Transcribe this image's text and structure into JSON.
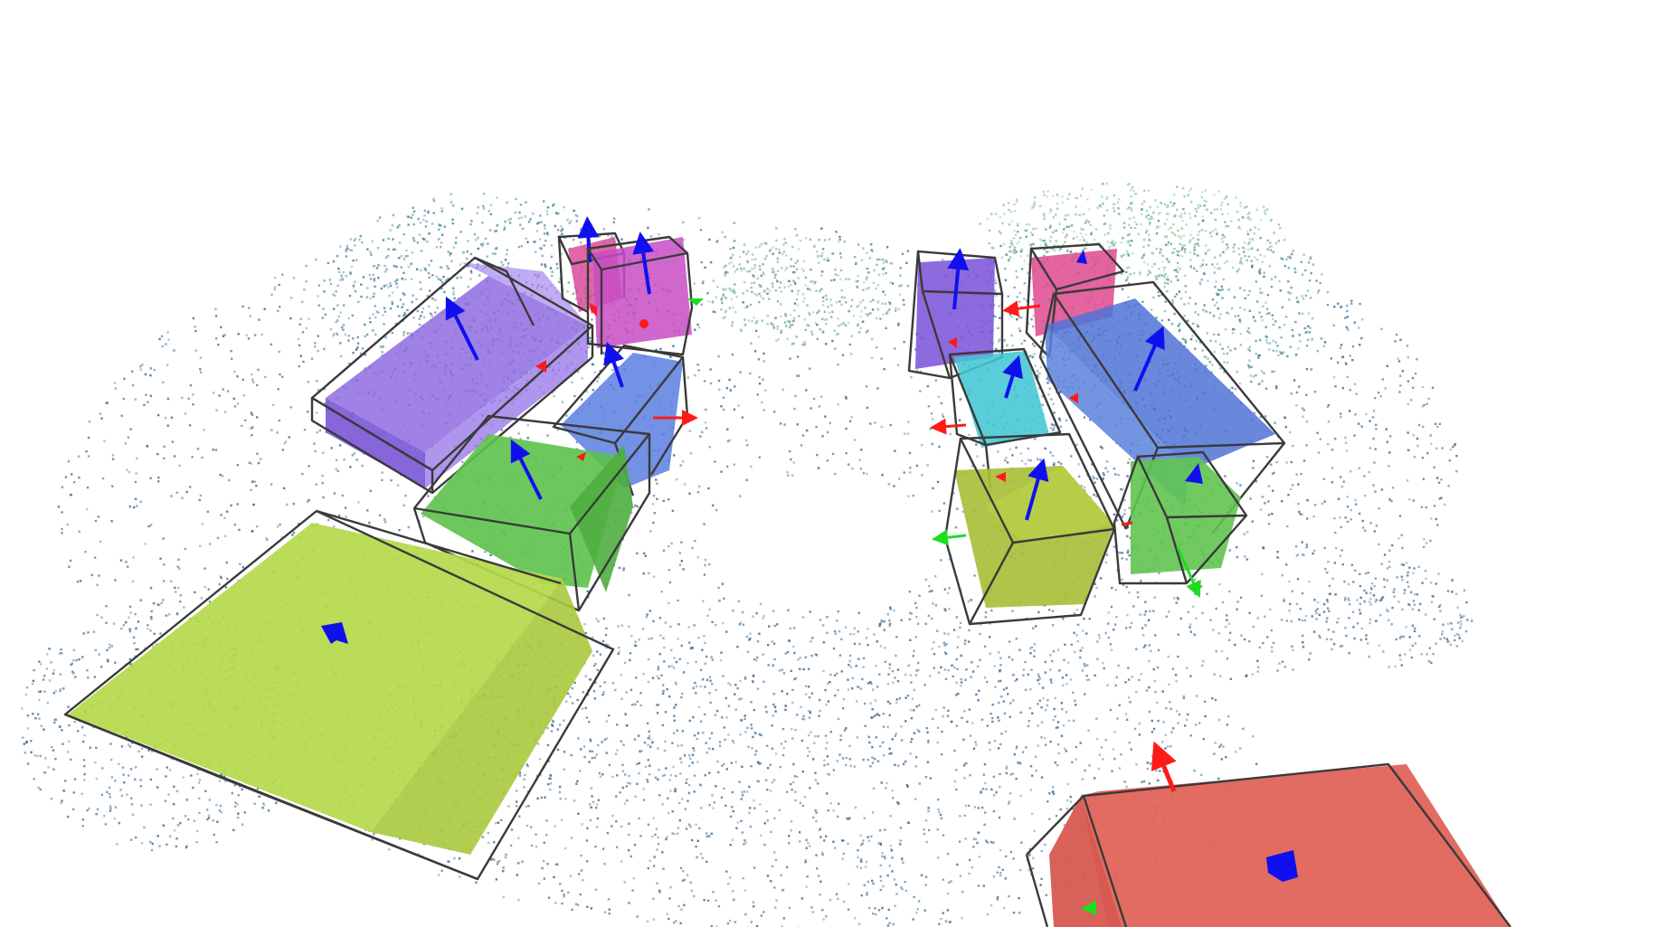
{
  "scene": {
    "background": "#ffffff",
    "point_cloud_color_near": "#2f5f85",
    "point_cloud_color_far": "#7fbf8a",
    "box_edge_color": "#3a3a3a",
    "axis_colors": {
      "x": "#ff1a1a",
      "y": "#1fdc1f",
      "z": "#1010ee"
    },
    "objects": [
      {
        "id": "sofa-left",
        "color": "#8f6be0"
      },
      {
        "id": "chair-back-left-pink",
        "color": "#d94c9a"
      },
      {
        "id": "chair-back-left-magenta",
        "color": "#c84cc4"
      },
      {
        "id": "chair-mid-left-blue",
        "color": "#5b7fe0"
      },
      {
        "id": "chair-front-left-green",
        "color": "#5cc24a"
      },
      {
        "id": "table-left-lime",
        "color": "#b4d94a"
      },
      {
        "id": "chair-back-right-purple",
        "color": "#7d55d8"
      },
      {
        "id": "chair-back-right-pink",
        "color": "#df4f91"
      },
      {
        "id": "chair-mid-right-cyan",
        "color": "#43c7d3"
      },
      {
        "id": "sofa-right-blue",
        "color": "#4f73d6"
      },
      {
        "id": "chair-front-right-olive",
        "color": "#a9bf3a"
      },
      {
        "id": "chair-front-right-green",
        "color": "#61c450"
      },
      {
        "id": "table-front-right-red",
        "color": "#e0635a"
      }
    ]
  }
}
